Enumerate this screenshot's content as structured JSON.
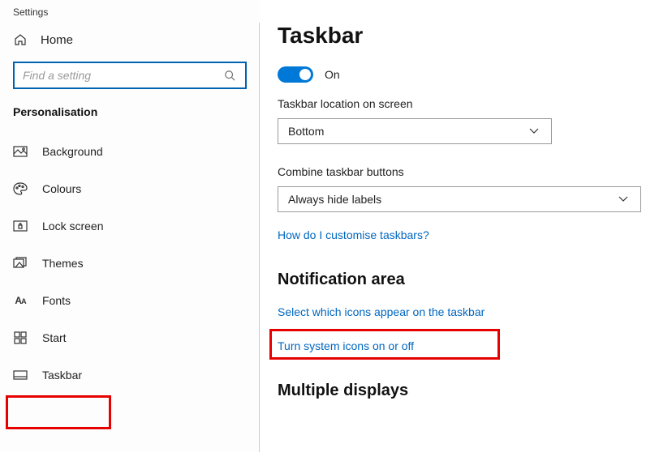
{
  "app_title": "Settings",
  "sidebar": {
    "home_label": "Home",
    "search": {
      "placeholder": "Find a setting"
    },
    "section_title": "Personalisation",
    "items": [
      {
        "label": "Background"
      },
      {
        "label": "Colours"
      },
      {
        "label": "Lock screen"
      },
      {
        "label": "Themes"
      },
      {
        "label": "Fonts"
      },
      {
        "label": "Start"
      },
      {
        "label": "Taskbar"
      }
    ]
  },
  "main": {
    "title": "Taskbar",
    "toggle": {
      "state": "On"
    },
    "location": {
      "label": "Taskbar location on screen",
      "value": "Bottom"
    },
    "combine": {
      "label": "Combine taskbar buttons",
      "value": "Always hide labels"
    },
    "help_link": "How do I customise taskbars?",
    "notification": {
      "heading": "Notification area",
      "link1": "Select which icons appear on the taskbar",
      "link2": "Turn system icons on or off"
    },
    "multiple": {
      "heading": "Multiple displays"
    }
  }
}
